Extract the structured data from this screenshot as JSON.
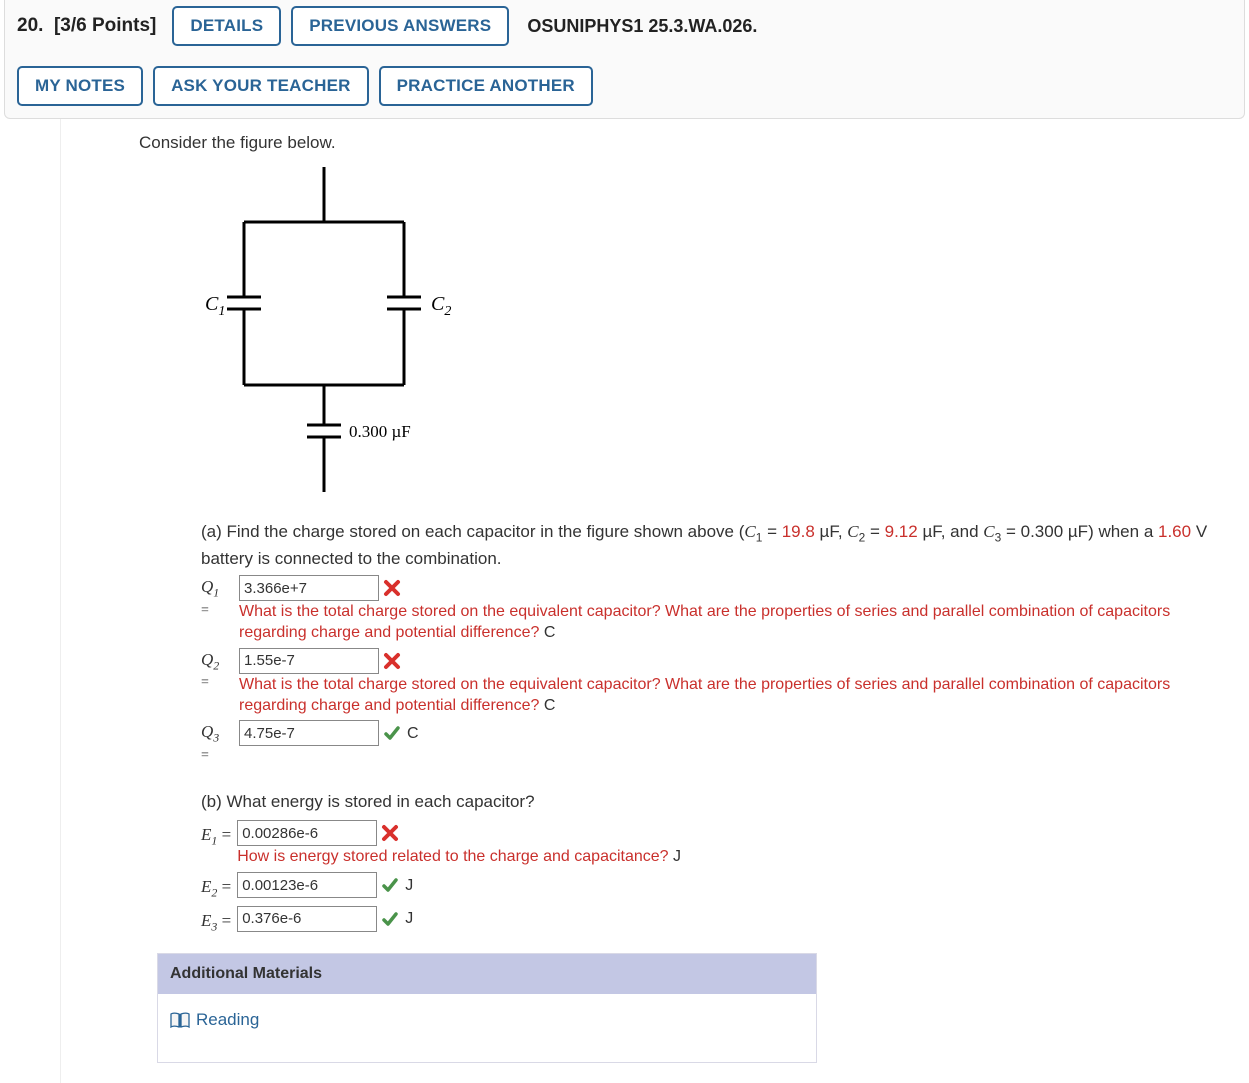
{
  "header": {
    "question_number": "20.",
    "points": "[3/6 Points]",
    "details": "DETAILS",
    "previous_answers": "PREVIOUS ANSWERS",
    "ref": "OSUNIPHYS1 25.3.WA.026.",
    "my_notes": "MY NOTES",
    "ask_teacher": "ASK YOUR TEACHER",
    "practice_another": "PRACTICE ANOTHER"
  },
  "prompt": "Consider the figure below.",
  "figure": {
    "c1_label": "C",
    "c1_sub": "1",
    "c2_label": "C",
    "c2_sub": "2",
    "c3_label": "0.300 µF"
  },
  "part_a": {
    "text_pre": "(a) Find the charge stored on each capacitor in the figure shown above (",
    "c1_sym": "C",
    "c1_sub": "1",
    "c1_eq": " = ",
    "c1_val": "19.8",
    "c1_unit": " µF, ",
    "c2_sym": "C",
    "c2_sub": "2",
    "c2_eq": " = ",
    "c2_val": "9.12",
    "c2_unit": " µF, and ",
    "c3_sym": "C",
    "c3_sub": "3",
    "c3_eq": " = 0.300 µF) when a ",
    "volt": "1.60",
    "text_post": " V battery is connected to the combination.",
    "rows": [
      {
        "label_sym": "Q",
        "label_sub": "1",
        "value": "3.366e+7",
        "status": "wrong",
        "feedback": "What is the total charge stored on the equivalent capacitor? What are the properties of series and parallel combination of capacitors regarding charge and potential difference?",
        "unit": "C"
      },
      {
        "label_sym": "Q",
        "label_sub": "2",
        "value": "1.55e-7",
        "status": "wrong",
        "feedback": "What is the total charge stored on the equivalent capacitor? What are the properties of series and parallel combination of capacitors regarding charge and potential difference?",
        "unit": "C"
      },
      {
        "label_sym": "Q",
        "label_sub": "3",
        "value": "4.75e-7",
        "status": "correct",
        "feedback": "",
        "unit": "C"
      }
    ]
  },
  "part_b": {
    "header": "(b) What energy is stored in each capacitor?",
    "rows": [
      {
        "label_sym": "E",
        "label_sub": "1",
        "value": "0.00286e-6",
        "status": "wrong",
        "feedback": "How is energy stored related to the charge and capacitance?",
        "unit": "J"
      },
      {
        "label_sym": "E",
        "label_sub": "2",
        "value": "0.00123e-6",
        "status": "correct",
        "feedback": "",
        "unit": "J"
      },
      {
        "label_sym": "E",
        "label_sub": "3",
        "value": "0.376e-6",
        "status": "correct",
        "feedback": "",
        "unit": "J"
      }
    ]
  },
  "additional": {
    "title": "Additional Materials",
    "reading": "Reading"
  }
}
